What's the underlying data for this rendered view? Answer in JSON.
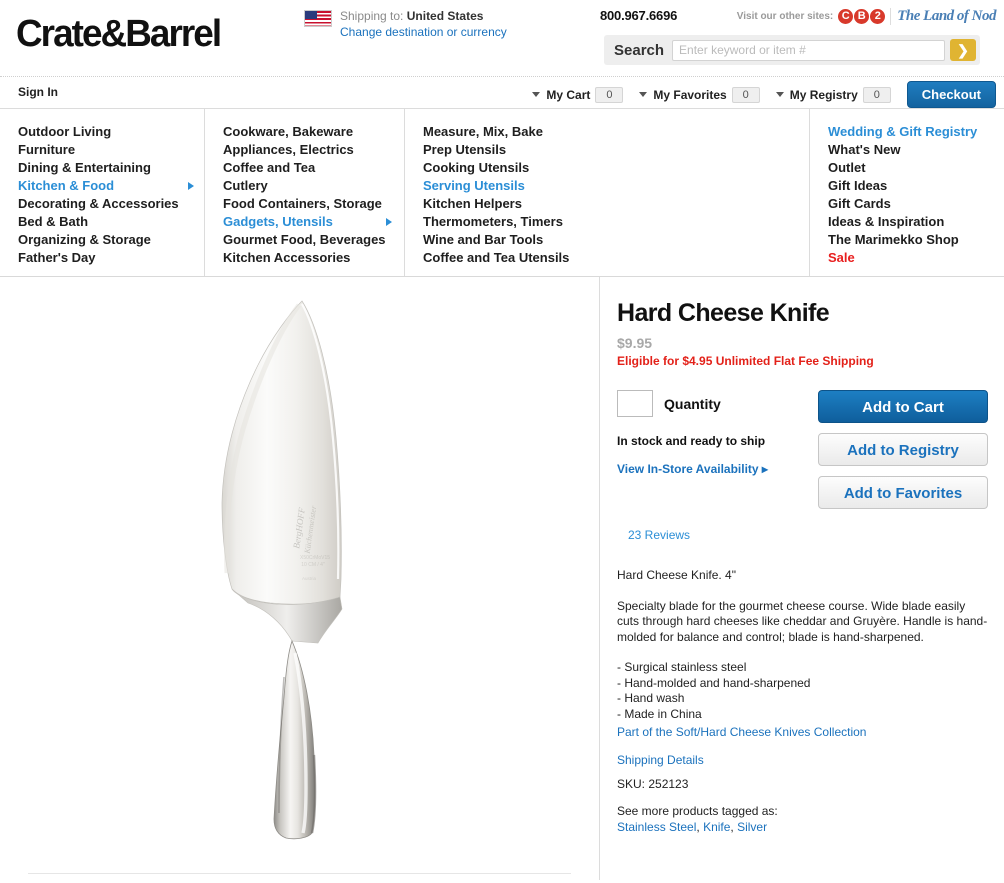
{
  "header": {
    "logo": "Crate&Barrel",
    "shipping_prefix": "Shipping to:",
    "shipping_country": "United States",
    "change_destination": "Change destination or currency",
    "phone": "800.967.6696",
    "other_sites_label": "Visit our other sites:",
    "cb2_letters": [
      "C",
      "B",
      "2"
    ],
    "land_of_nod": "The Land of Nod",
    "flag_icon": "us-flag-icon"
  },
  "search": {
    "label": "Search",
    "placeholder": "Enter keyword or item #",
    "value": "",
    "go_icon": "chevron-right-icon"
  },
  "account": {
    "sign_in": "Sign In",
    "items": [
      {
        "label": "My Cart",
        "count": "0"
      },
      {
        "label": "My Favorites",
        "count": "0"
      },
      {
        "label": "My Registry",
        "count": "0"
      }
    ],
    "checkout": "Checkout"
  },
  "nav": {
    "col1": [
      {
        "label": "Outdoor Living",
        "state": "normal",
        "arrow": false
      },
      {
        "label": "Furniture",
        "state": "normal",
        "arrow": false
      },
      {
        "label": "Dining & Entertaining",
        "state": "normal",
        "arrow": false
      },
      {
        "label": "Kitchen & Food",
        "state": "selected",
        "arrow": true
      },
      {
        "label": "Decorating & Accessories",
        "state": "normal",
        "arrow": false
      },
      {
        "label": "Bed & Bath",
        "state": "normal",
        "arrow": false
      },
      {
        "label": "Organizing & Storage",
        "state": "normal",
        "arrow": false
      },
      {
        "label": "Father's Day",
        "state": "normal",
        "arrow": false
      }
    ],
    "col2": [
      {
        "label": "Cookware, Bakeware",
        "state": "normal",
        "arrow": false
      },
      {
        "label": "Appliances, Electrics",
        "state": "normal",
        "arrow": false
      },
      {
        "label": "Coffee and Tea",
        "state": "normal",
        "arrow": false
      },
      {
        "label": "Cutlery",
        "state": "normal",
        "arrow": false
      },
      {
        "label": "Food Containers, Storage",
        "state": "normal",
        "arrow": false
      },
      {
        "label": "Gadgets, Utensils",
        "state": "selected",
        "arrow": true
      },
      {
        "label": "Gourmet Food, Beverages",
        "state": "normal",
        "arrow": false
      },
      {
        "label": "Kitchen Accessories",
        "state": "normal",
        "arrow": false
      }
    ],
    "col3": [
      {
        "label": "Measure, Mix, Bake",
        "state": "normal",
        "arrow": false
      },
      {
        "label": "Prep Utensils",
        "state": "normal",
        "arrow": false
      },
      {
        "label": "Cooking Utensils",
        "state": "normal",
        "arrow": false
      },
      {
        "label": "Serving Utensils",
        "state": "selected",
        "arrow": false
      },
      {
        "label": "Kitchen Helpers",
        "state": "normal",
        "arrow": false
      },
      {
        "label": "Thermometers, Timers",
        "state": "normal",
        "arrow": false
      },
      {
        "label": "Wine and Bar Tools",
        "state": "normal",
        "arrow": false
      },
      {
        "label": "Coffee and Tea Utensils",
        "state": "normal",
        "arrow": false
      }
    ],
    "col4": [
      {
        "label": "Wedding & Gift Registry",
        "state": "registry",
        "arrow": false
      },
      {
        "label": "What's New",
        "state": "normal",
        "arrow": false
      },
      {
        "label": "Outlet",
        "state": "normal",
        "arrow": false
      },
      {
        "label": "Gift Ideas",
        "state": "normal",
        "arrow": false
      },
      {
        "label": "Gift Cards",
        "state": "normal",
        "arrow": false
      },
      {
        "label": "Ideas & Inspiration",
        "state": "normal",
        "arrow": false
      },
      {
        "label": "The Marimekko Shop",
        "state": "normal",
        "arrow": false
      },
      {
        "label": "Sale",
        "state": "sale",
        "arrow": false
      }
    ]
  },
  "product": {
    "image_alt": "hard-cheese-knife-photo",
    "blade_engraving": "BergHOFF",
    "title": "Hard Cheese Knife",
    "price": "$9.95",
    "shipping_eligibility": "Eligible for $4.95 Unlimited Flat Fee Shipping",
    "quantity_value": "",
    "quantity_label": "Quantity",
    "stock_status": "In stock and ready to ship",
    "in_store_link": "View In-Store Availability ▸",
    "add_to_cart": "Add to Cart",
    "add_to_registry": "Add to Registry",
    "add_to_favorites": "Add to Favorites",
    "reviews": "23 Reviews",
    "short_desc": "Hard Cheese Knife. 4\"",
    "long_desc": "Specialty blade for the gourmet cheese course. Wide blade easily cuts through hard cheeses like cheddar and Gruyère. Handle is hand-molded for balance and control; blade is hand-sharpened.",
    "features": [
      "- Surgical stainless steel",
      "- Hand-molded and hand-sharpened",
      "- Hand wash",
      "- Made in China"
    ],
    "collection_link": "Part of the Soft/Hard Cheese Knives Collection",
    "shipping_details_link": "Shipping Details",
    "sku": "SKU: 252123",
    "tagged_label": "See more products tagged as:",
    "tags": [
      "Stainless Steel",
      "Knife",
      "Silver"
    ]
  },
  "colors": {
    "link_blue": "#1b72bd",
    "nav_blue": "#2b8ed6",
    "sale_red": "#e81f1f",
    "ship_red": "#e32119",
    "accent_gold": "#e0b432",
    "button_blue": "#0f5e9c"
  }
}
